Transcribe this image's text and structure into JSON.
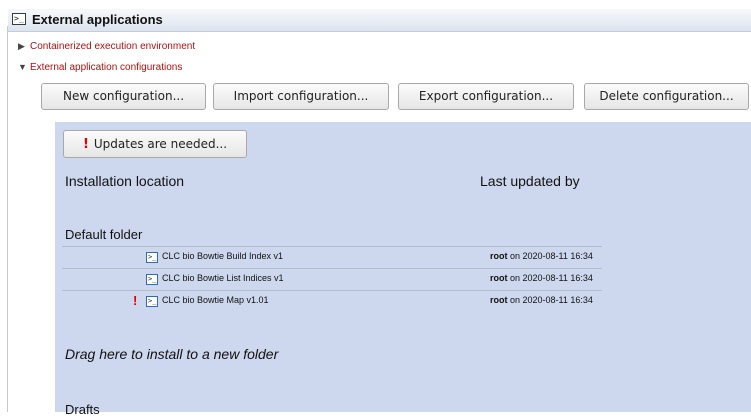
{
  "header": {
    "title": "External applications",
    "icon": "terminal-icon"
  },
  "tree": {
    "containerized": {
      "label": "Containerized execution environment",
      "expanded": false
    },
    "configurations": {
      "label": "External application configurations",
      "expanded": true
    }
  },
  "toolbar": {
    "new_label": "New configuration...",
    "import_label": "Import configuration...",
    "export_label": "Export configuration...",
    "delete_label": "Delete configuration..."
  },
  "panel": {
    "updates_button": {
      "bang": "!",
      "label": "Updates are needed..."
    },
    "col_location": "Installation location",
    "col_updated": "Last updated by",
    "default_folder": {
      "title": "Default folder",
      "rows": [
        {
          "name": "CLC bio Bowtie Build Index v1",
          "user": "root",
          "when": " on 2020-08-11 16:34",
          "warning": false
        },
        {
          "name": "CLC bio Bowtie List Indices v1",
          "user": "root",
          "when": " on 2020-08-11 16:34",
          "warning": false
        },
        {
          "name": "CLC bio Bowtie Map v1.01",
          "user": "root",
          "when": " on 2020-08-11 16:34",
          "warning": true
        }
      ]
    },
    "drag_text": "Drag here to install to a new folder",
    "drafts_title": "Drafts"
  },
  "colors": {
    "panel_bg": "#cdd8ee",
    "tree_text": "#b01010",
    "warning": "#e00000"
  }
}
